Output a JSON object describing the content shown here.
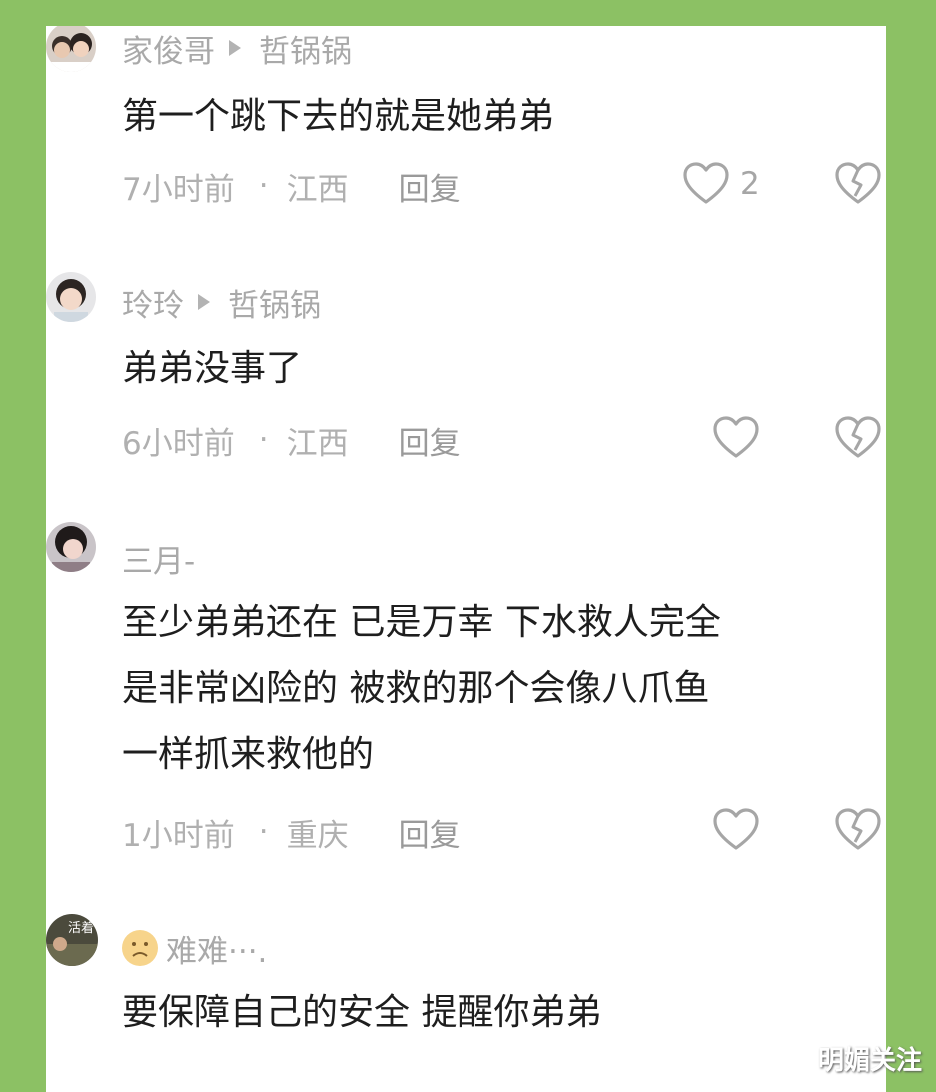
{
  "comments": [
    {
      "author": "家俊哥",
      "reply_to": "哲锅锅",
      "text": "第一个跳下去的就是她弟弟",
      "time": "7小时前",
      "location": "江西",
      "reply_label": "回复",
      "likes": "2"
    },
    {
      "author": "玲玲",
      "reply_to": "哲锅锅",
      "text": "弟弟没事了",
      "time": "6小时前",
      "location": "江西",
      "reply_label": "回复",
      "likes": ""
    },
    {
      "author": "三月-",
      "reply_to": "",
      "text": "至少弟弟还在 已是万幸 下水救人完全\n是非常凶险的 被救的那个会像八爪鱼\n一样抓来救他的",
      "time": "1小时前",
      "location": "重庆",
      "reply_label": "回复",
      "likes": ""
    },
    {
      "author": "难难···.",
      "reply_to": "",
      "avatar_text": "活着",
      "text": "要保障自己的安全 提醒你弟弟",
      "time": "",
      "location": "",
      "reply_label": "",
      "likes": ""
    }
  ],
  "watermark": "明媚关注",
  "colors": {
    "frame": "#8cc164",
    "panel": "#ffffff",
    "text": "#1e1e1e",
    "muted": "#a9a9a9"
  }
}
